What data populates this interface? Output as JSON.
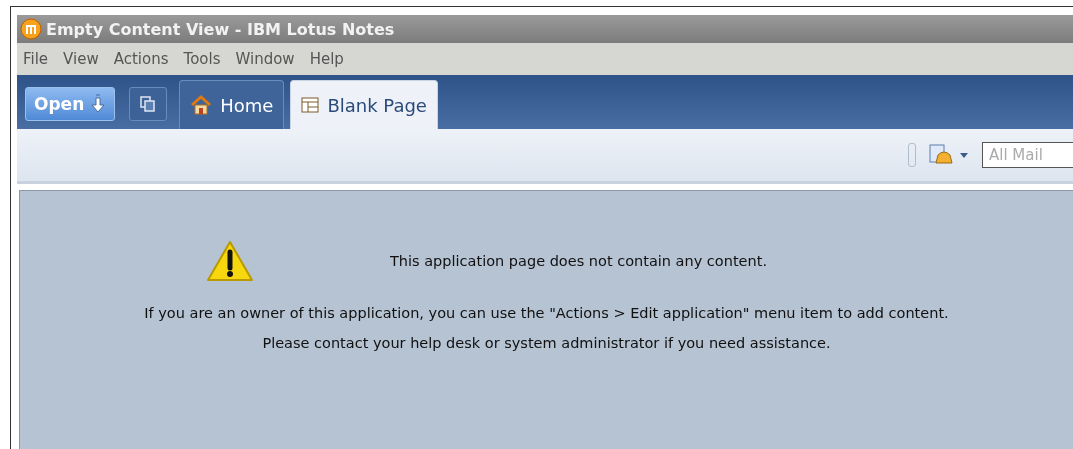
{
  "window": {
    "title": "Empty Content View - IBM Lotus Notes"
  },
  "menu": [
    "File",
    "View",
    "Actions",
    "Tools",
    "Window",
    "Help"
  ],
  "open_button": {
    "label": "Open"
  },
  "tabs": [
    {
      "label": "Home",
      "kind": "home",
      "selected": false
    },
    {
      "label": "Blank Page",
      "kind": "page",
      "selected": true
    }
  ],
  "search": {
    "placeholder": "All Mail"
  },
  "message": {
    "headline": "This application page does not contain any content.",
    "lines": [
      "If you are an owner of this application, you can use the \"Actions > Edit application\" menu item to add content.",
      "Please contact your help desk or system administrator if you need assistance."
    ]
  }
}
